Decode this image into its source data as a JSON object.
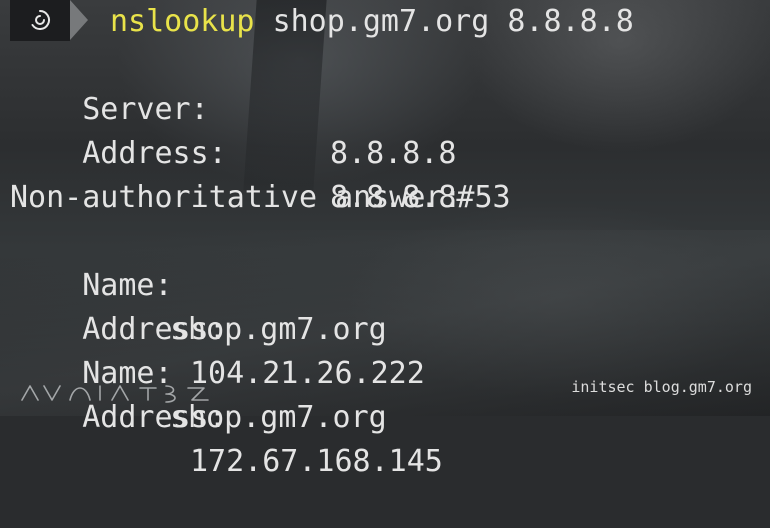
{
  "prompt": {
    "icon": "debian-swirl-icon",
    "command": "nslookup",
    "args": "shop.gm7.org 8.8.8.8"
  },
  "output": {
    "server_label": "Server:",
    "server_value": "8.8.8.8",
    "address_label": "Address:",
    "address_value": "8.8.8.8#53",
    "answer_header": "Non-authoritative answer:",
    "records": [
      {
        "name_label": "Name:",
        "name_value": "shop.gm7.org",
        "address_label": "Address:",
        "address_value": "104.21.26.222"
      },
      {
        "name_label": "Name:",
        "name_value": "shop.gm7.org",
        "address_label": "Address:",
        "address_value": "172.67.168.145"
      }
    ]
  },
  "watermark": "initsec blog.gm7.org",
  "colors": {
    "command": "#e9e34a",
    "text": "#e4e4e4",
    "prompt_bg": "#1c1d1f",
    "prompt_arrow": "#77797b"
  }
}
